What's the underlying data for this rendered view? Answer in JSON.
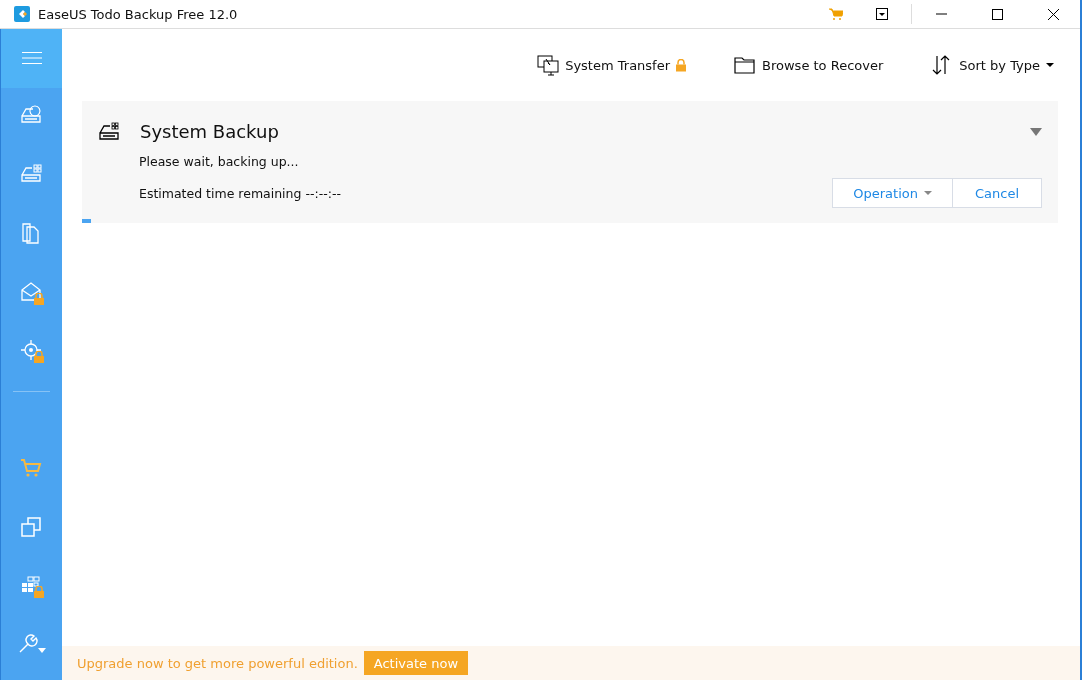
{
  "window": {
    "title": "EaseUS Todo Backup Free 12.0"
  },
  "sidebar": {
    "items": [
      {
        "kind": "disk-backup",
        "locked": false
      },
      {
        "kind": "system-backup",
        "locked": false
      },
      {
        "kind": "file-backup",
        "locked": false
      },
      {
        "kind": "mail-backup",
        "locked": true
      },
      {
        "kind": "smart-backup",
        "locked": true
      },
      {
        "kind": "divider"
      },
      {
        "kind": "cart",
        "locked": false
      },
      {
        "kind": "clone",
        "locked": false
      },
      {
        "kind": "tiles",
        "locked": true
      },
      {
        "kind": "tools",
        "locked": false
      }
    ]
  },
  "toolbar": [
    {
      "kind": "transfer",
      "label": "System Transfer",
      "locked": true
    },
    {
      "kind": "folder",
      "label": "Browse to Recover",
      "locked": false
    },
    {
      "kind": "sort",
      "label": "Sort by Type",
      "locked": false
    }
  ],
  "task": {
    "title": "System Backup",
    "status": "Please wait, backing up...",
    "time": "Estimated time remaining --:--:--",
    "level": 0.009,
    "buttons": [
      {
        "label": "Operation",
        "kind": "dropdown"
      },
      {
        "label": "Cancel",
        "kind": "plain"
      }
    ]
  },
  "banner": {
    "text": "Upgrade now to get more powerful edition.",
    "button": "Activate now"
  }
}
